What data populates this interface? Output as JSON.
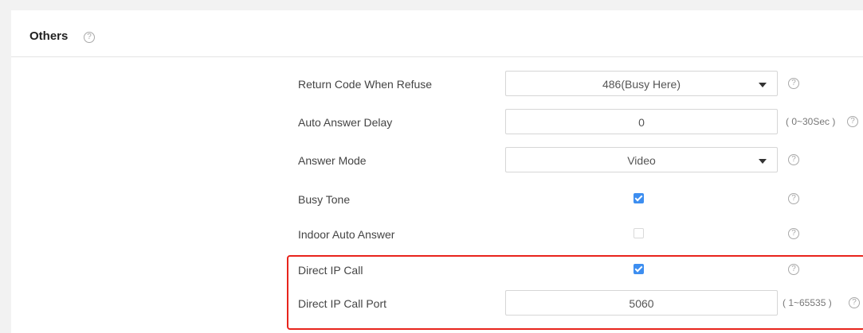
{
  "section": {
    "title": "Others",
    "help_glyph": "?"
  },
  "settings": {
    "return_code": {
      "label": "Return Code When Refuse",
      "value": "486(Busy Here)",
      "help": "?"
    },
    "auto_answer_delay": {
      "label": "Auto Answer Delay",
      "value": "0",
      "range": "( 0~30Sec )",
      "help": "?"
    },
    "answer_mode": {
      "label": "Answer Mode",
      "value": "Video",
      "help": "?"
    },
    "busy_tone": {
      "label": "Busy Tone",
      "checked": true,
      "help": "?"
    },
    "indoor_auto_answer": {
      "label": "Indoor Auto Answer",
      "checked": false,
      "help": "?"
    },
    "direct_ip_call": {
      "label": "Direct IP Call",
      "checked": true,
      "help": "?"
    },
    "direct_ip_call_port": {
      "label": "Direct IP Call Port",
      "value": "5060",
      "range": "( 1~65535 )",
      "help": "?"
    }
  },
  "colors": {
    "checkbox_accent": "#3d8ef0",
    "highlight": "#e8241c"
  },
  "icons": {
    "help": "question-circle-icon",
    "dropdown": "caret-down-icon",
    "check": "checkmark-icon"
  }
}
